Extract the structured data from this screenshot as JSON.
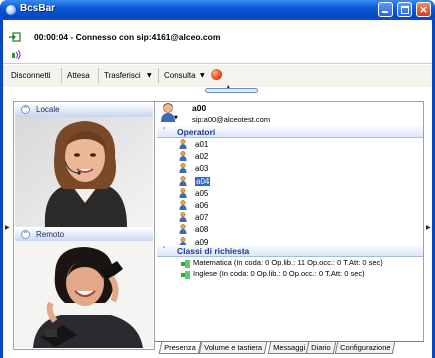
{
  "window": {
    "title": "BcsBar"
  },
  "status": {
    "text": "00:00:04 - Connesso con sip:4161@alceo.com"
  },
  "toolbar": {
    "disconnect_label": "Disconnetti",
    "hold_label": "Attesa",
    "transfer_label": "Trasferisci",
    "consult_label": "Consulta"
  },
  "panels": {
    "local_label": "Locale",
    "remote_label": "Remoto"
  },
  "user": {
    "name": "a00",
    "sip": "sip:a00@alceotest.com"
  },
  "operators": {
    "header": "Operatori",
    "items": [
      "a01",
      "a02",
      "a03",
      "a04",
      "a05",
      "a06",
      "a07",
      "a08",
      "a09"
    ],
    "selected": "a04"
  },
  "classes": {
    "header": "Classi di richiesta",
    "items": [
      "Matematica (In coda: 0  Op.lib.: 11  Op.occ.: 0  T.Att: 0 sec)",
      "Inglese (In coda: 0  Op.lib.: 0  Op.occ.: 0  T.Att: 0 sec)"
    ]
  },
  "tabs": [
    "Presenza",
    "Volume e tastiera",
    "Messaggi",
    "Diario",
    "Configurazione"
  ],
  "active_tab": "Presenza",
  "colors": {
    "titlebar": "#0a5ad8",
    "selection": "#316ac5",
    "group_header": "#1b3a8a"
  }
}
